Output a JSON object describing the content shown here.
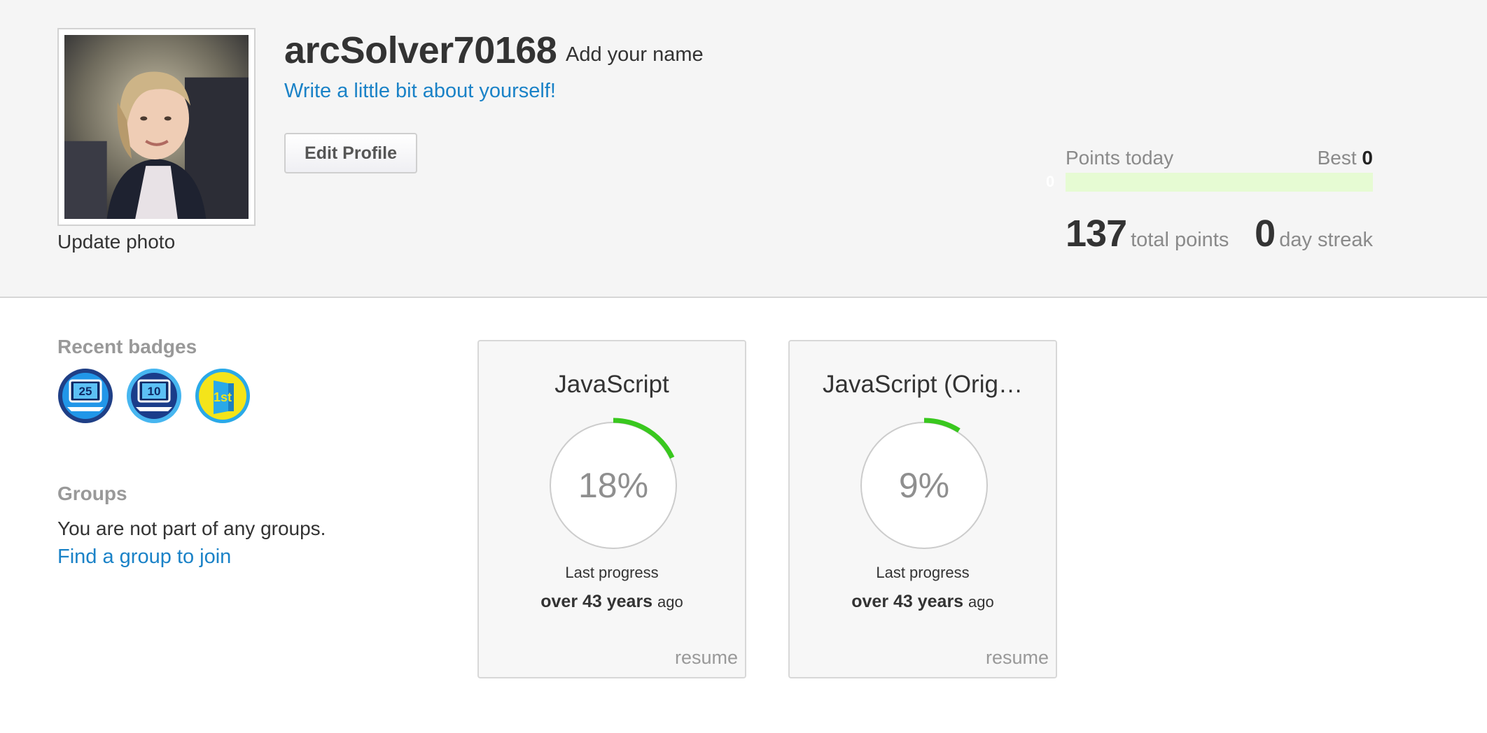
{
  "profile": {
    "username": "arcSolver70168",
    "add_name": "Add your name",
    "about_prompt": "Write a little bit about yourself!",
    "edit_button": "Edit Profile",
    "update_photo": "Update photo"
  },
  "stats": {
    "points_today_label": "Points today",
    "best_label": "Best",
    "best_value": "0",
    "points_today_value": "0",
    "points_today_fraction": 0,
    "total_points": "137",
    "total_points_label": "total points",
    "day_streak": "0",
    "day_streak_label": "day streak",
    "colors": {
      "track": "#e6fbd3",
      "fill": "#6fd23a"
    }
  },
  "badges": {
    "title": "Recent badges",
    "items": [
      {
        "icon": "computer-badge-icon",
        "label": "25",
        "ring": "#1f3f86",
        "inner": "#2196e8"
      },
      {
        "icon": "computer-badge-icon",
        "label": "10",
        "ring": "#47b6f0",
        "inner": "#1a3d8a"
      },
      {
        "icon": "door-badge-icon",
        "label": "1st",
        "ring": "#2aa9e8",
        "inner": "#f4e41a"
      }
    ]
  },
  "groups": {
    "title": "Groups",
    "empty_text": "You are not part of any groups.",
    "find_link": "Find a group to join"
  },
  "courses": [
    {
      "title": "JavaScript",
      "percent_label": "18%",
      "percent": 18,
      "last_progress_label": "Last progress",
      "last_progress_bold": "over 43 years",
      "last_progress_suffix": "ago",
      "resume": "resume"
    },
    {
      "title": "JavaScript (Orig…",
      "percent_label": "9%",
      "percent": 9,
      "last_progress_label": "Last progress",
      "last_progress_bold": "over 43 years",
      "last_progress_suffix": "ago",
      "resume": "resume"
    }
  ],
  "colors": {
    "link": "#1a82c7",
    "ring_progress": "#39c81e",
    "ring_track": "#cccccc"
  }
}
